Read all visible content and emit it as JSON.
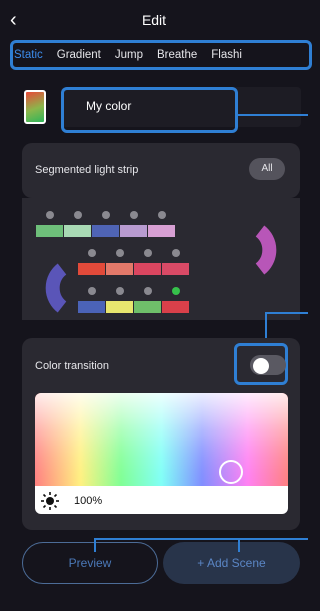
{
  "header": {
    "title": "Edit",
    "back_icon": "chevron-left-icon"
  },
  "tabs": [
    {
      "label": "Static",
      "active": true
    },
    {
      "label": "Gradient",
      "active": false
    },
    {
      "label": "Jump",
      "active": false
    },
    {
      "label": "Breathe",
      "active": false
    },
    {
      "label": "Flashi",
      "active": false
    }
  ],
  "color_name": {
    "value": "My color"
  },
  "segmented": {
    "label": "Segmented light strip",
    "all_button": "All"
  },
  "strip": {
    "rows": [
      [
        "#6ebf7a",
        "#a8d9b4",
        "#4f64b5",
        "#b89bd0",
        "#d79fd3"
      ],
      [
        "#e24a3a",
        "#e3796a",
        "#db4660",
        "#d94a66"
      ],
      [
        "#4b63b8",
        "#e8e66f",
        "#6fbf6a",
        "#d9404a"
      ]
    ],
    "check_color": "#8a8990",
    "active_check_color": "#36c14b"
  },
  "transition": {
    "label": "Color transition",
    "toggle_on": false
  },
  "brightness": {
    "label": "100%",
    "icon": "sun-icon"
  },
  "actions": {
    "preview": "Preview",
    "add_scene": "+ Add Scene"
  },
  "colors": {
    "accent": "#2f7fd4",
    "background": "#15141c",
    "card": "#2a2931"
  }
}
